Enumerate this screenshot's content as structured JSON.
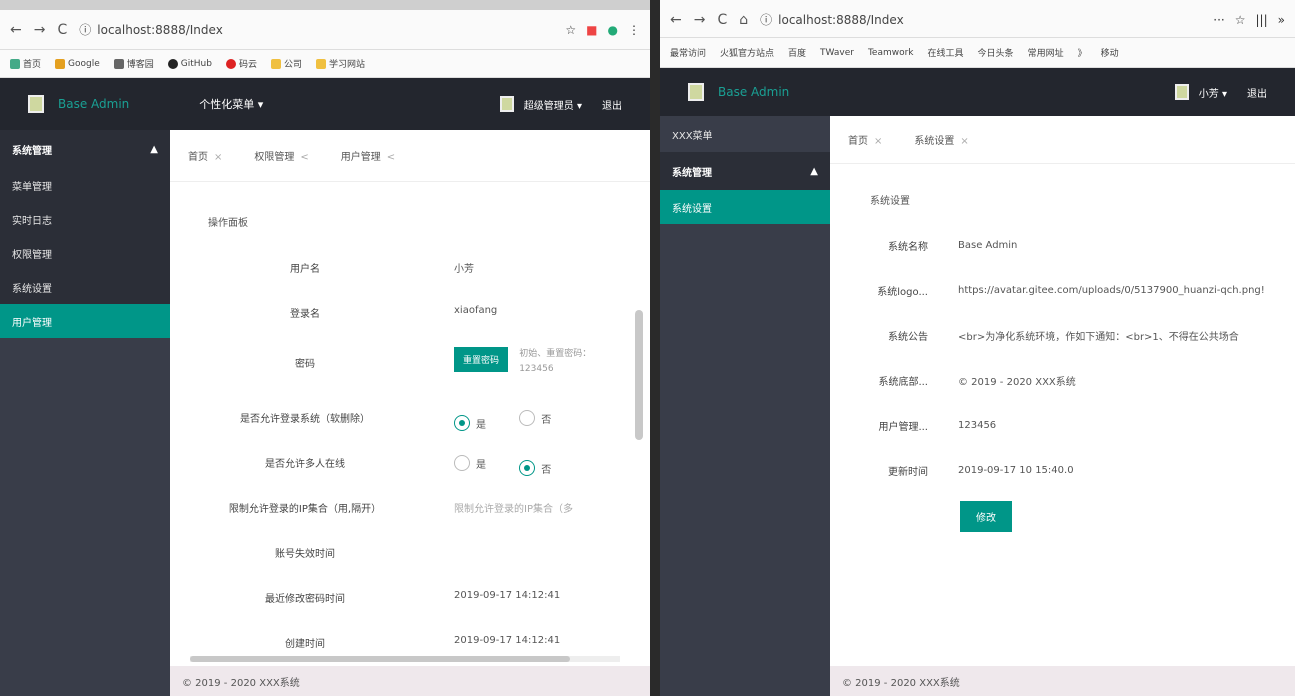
{
  "left": {
    "url": "localhost:8888/Index",
    "bookmarks": [
      "首页",
      "Google",
      "博客园",
      "GitHub",
      "码云",
      "公司",
      "学习网站"
    ],
    "app": {
      "brand": "Base Admin",
      "menu": "个性化菜单 ▾",
      "user": "超级管理员 ▾",
      "logout": "退出"
    },
    "sidebar": {
      "head": "系统管理",
      "items": [
        "菜单管理",
        "实时日志",
        "权限管理",
        "系统设置",
        "用户管理"
      ],
      "active_index": 4
    },
    "tabs": [
      {
        "label": "首页",
        "close": "×"
      },
      {
        "label": "权限管理",
        "close": "<"
      },
      {
        "label": "用户管理",
        "close": "<"
      }
    ],
    "form": {
      "title": "操作面板",
      "username": {
        "label": "用户名",
        "value": "小芳"
      },
      "loginname": {
        "label": "登录名",
        "value": "xiaofang"
      },
      "password": {
        "label": "密码",
        "button": "重置密码",
        "hint1": "初始、重置密码：",
        "hint2": "123456"
      },
      "allow_login": {
        "label": "是否允许登录系统（软删除）",
        "yes": "是",
        "no": "否",
        "selected": "是"
      },
      "allow_multi": {
        "label": "是否允许多人在线",
        "yes": "是",
        "no": "否",
        "selected": "否"
      },
      "ip_limit": {
        "label": "限制允许登录的IP集合（用,隔开）",
        "placeholder": "限制允许登录的IP集合（多"
      },
      "expire": {
        "label": "账号失效时间",
        "value": ""
      },
      "pwd_time": {
        "label": "最近修改密码时间",
        "value": "2019-09-17 14:12:41"
      },
      "create_time": {
        "label": "创建时间",
        "value": "2019-09-17 14:12:41"
      }
    },
    "footer": "© 2019 - 2020 XXX系统"
  },
  "right": {
    "url": "localhost:8888/Index",
    "bookmarks": [
      "最常访问",
      "火狐官方站点",
      "百度",
      "TWaver",
      "Teamwork",
      "在线工具",
      "今日头条",
      "常用网址",
      "》",
      "移动"
    ],
    "app": {
      "brand": "Base Admin",
      "user": "小芳 ▾",
      "logout": "退出"
    },
    "sidebar": {
      "top": "XXX菜单",
      "head": "系统管理",
      "items": [
        "系统设置"
      ],
      "active_index": 0
    },
    "tabs": [
      {
        "label": "首页",
        "close": "×"
      },
      {
        "label": "系统设置",
        "close": "×"
      }
    ],
    "settings": {
      "title": "系统设置",
      "rows": [
        {
          "label": "系统名称",
          "value": "Base Admin"
        },
        {
          "label": "系统logo...",
          "value": "https://avatar.gitee.com/uploads/0/5137900_huanzi-qch.png!"
        },
        {
          "label": "系统公告",
          "value": "<br>为净化系统环境，作如下通知：<br>1、不得在公共场合"
        },
        {
          "label": "系统底部...",
          "value": "© 2019 - 2020 XXX系统"
        },
        {
          "label": "用户管理...",
          "value": "123456"
        },
        {
          "label": "更新时间",
          "value": "2019-09-17 10 15:40.0"
        }
      ],
      "submit": "修改"
    },
    "footer": "© 2019 - 2020 XXX系统"
  }
}
